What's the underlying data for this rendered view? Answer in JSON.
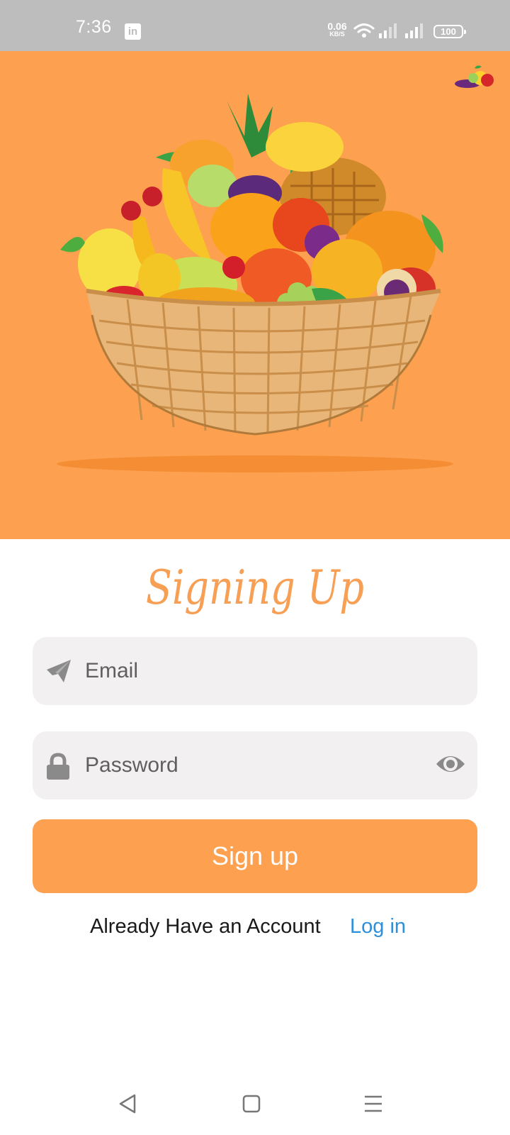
{
  "status_bar": {
    "time": "7:36",
    "notification_icon": "linkedin-icon",
    "net_speed_value": "0.06",
    "net_speed_unit": "KB/S",
    "wifi_icon": "wifi-icon",
    "signal_icon": "signal-icon",
    "battery_level": "100"
  },
  "hero": {
    "image": "fruit-basket-illustration",
    "corner_icon": "mini-fruit-logo-icon",
    "background_color": "#fda04f"
  },
  "form": {
    "title": "Signing Up",
    "email_placeholder": "Email",
    "email_icon": "paper-plane-icon",
    "password_placeholder": "Password",
    "password_icon": "lock-icon",
    "password_toggle_icon": "eye-icon",
    "submit_label": "Sign up",
    "account_prompt": "Already Have an Account",
    "login_link": "Log in"
  },
  "colors": {
    "accent": "#fda04f",
    "title": "#f7a055",
    "link": "#2f8fd8",
    "field_bg": "#f2f0f0"
  },
  "nav_bar": {
    "back_icon": "back-triangle-icon",
    "home_icon": "home-square-icon",
    "menu_icon": "menu-lines-icon"
  }
}
